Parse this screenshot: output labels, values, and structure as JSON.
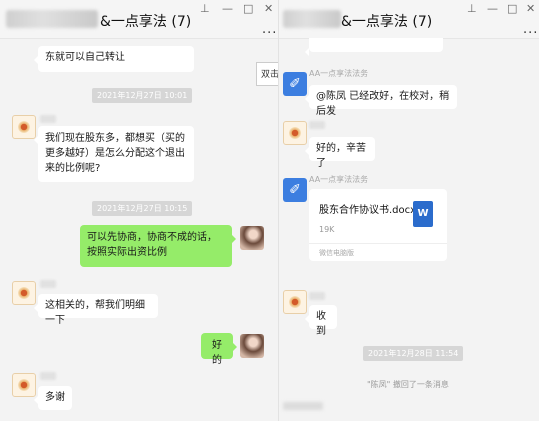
{
  "left_window": {
    "title": "&一点享法 (7)",
    "controls": {
      "pin": "⊥",
      "minimize": "—",
      "maximize": "□",
      "close": "✕"
    },
    "more": "...",
    "partial_message": "东就可以自己转让",
    "side_popup_label": "双击",
    "timestamp_1": "2021年12月27日 10:01",
    "message_1": "我们现在股东多，都想买（买的更多越好）是怎么分配这个退出来的比例呢?",
    "timestamp_2": "2021年12月27日 10:15",
    "reply_1": "可以先协商，协商不成的话，按照实际出资比例",
    "message_2": "这相关的，帮我们明细一下",
    "reply_2": "好的",
    "message_3": "多谢"
  },
  "right_window": {
    "title": "&一点享法 (7)",
    "controls": {
      "pin": "⊥",
      "minimize": "—",
      "maximize": "□",
      "close": "✕"
    },
    "more": "...",
    "sender_1": "AA一点享法法务",
    "message_1": "@陈凤 已经改好，在校对，稍后发",
    "message_2": "好的，辛苦了",
    "sender_2": "AA一点享法法务",
    "file": {
      "name": "股东合作协议书.docx",
      "size": "19K",
      "source": "微信电脑版",
      "icon_label": "W"
    },
    "message_3": "收到",
    "timestamp_1": "2021年12月28日 11:54",
    "recall_notice": "\"陈凤\" 撤回了一条消息"
  }
}
